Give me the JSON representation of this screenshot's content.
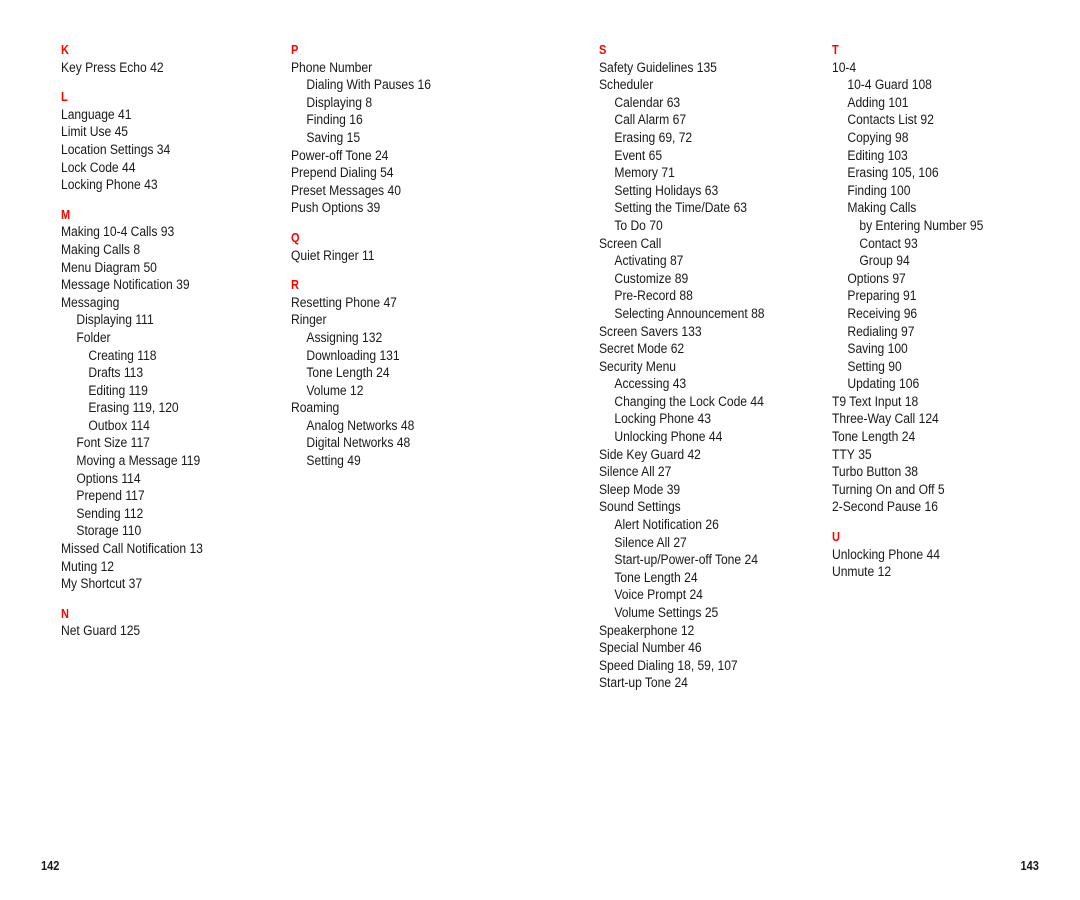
{
  "document": {
    "kind": "printed-index-spread",
    "accent_color": "#ff0000",
    "text_color": "#1a1a1a",
    "background_color": "#ffffff"
  },
  "folio": {
    "left": "142",
    "right": "143"
  },
  "columns": [
    {
      "id": "column-1",
      "groups": [
        {
          "letter": "K",
          "entries": [
            {
              "level": 0,
              "text": "Key Press Echo",
              "page": "42"
            }
          ]
        },
        {
          "letter": "L",
          "entries": [
            {
              "level": 0,
              "text": "Language",
              "page": "41"
            },
            {
              "level": 0,
              "text": "Limit Use",
              "page": "45"
            },
            {
              "level": 0,
              "text": "Location Settings",
              "page": "34"
            },
            {
              "level": 0,
              "text": "Lock Code",
              "page": "44"
            },
            {
              "level": 0,
              "text": "Locking Phone",
              "page": "43"
            }
          ]
        },
        {
          "letter": "M",
          "entries": [
            {
              "level": 0,
              "text": "Making 10-4 Calls",
              "page": "93"
            },
            {
              "level": 0,
              "text": "Making Calls",
              "page": "8"
            },
            {
              "level": 0,
              "text": "Menu Diagram",
              "page": "50"
            },
            {
              "level": 0,
              "text": "Message Notification",
              "page": "39"
            },
            {
              "level": 0,
              "text": "Messaging",
              "page": ""
            },
            {
              "level": 1,
              "text": "Displaying",
              "page": "111"
            },
            {
              "level": 1,
              "text": "Folder",
              "page": ""
            },
            {
              "level": 2,
              "text": "Creating",
              "page": "118"
            },
            {
              "level": 2,
              "text": "Drafts",
              "page": "113"
            },
            {
              "level": 2,
              "text": "Editing",
              "page": "119"
            },
            {
              "level": 2,
              "text": "Erasing",
              "page": "119, 120"
            },
            {
              "level": 2,
              "text": "Outbox",
              "page": "114"
            },
            {
              "level": 1,
              "text": "Font Size",
              "page": "117"
            },
            {
              "level": 1,
              "text": "Moving a Message",
              "page": "119"
            },
            {
              "level": 1,
              "text": "Options",
              "page": "114"
            },
            {
              "level": 1,
              "text": "Prepend",
              "page": "117"
            },
            {
              "level": 1,
              "text": "Sending",
              "page": "112"
            },
            {
              "level": 1,
              "text": "Storage",
              "page": "110"
            },
            {
              "level": 0,
              "text": "Missed Call Notification",
              "page": "13"
            },
            {
              "level": 0,
              "text": "Muting",
              "page": "12"
            },
            {
              "level": 0,
              "text": "My Shortcut",
              "page": "37"
            }
          ]
        },
        {
          "letter": "N",
          "entries": [
            {
              "level": 0,
              "text": "Net Guard",
              "page": "125"
            }
          ]
        }
      ]
    },
    {
      "id": "column-2",
      "groups": [
        {
          "letter": "P",
          "entries": [
            {
              "level": 0,
              "text": "Phone Number",
              "page": ""
            },
            {
              "level": 1,
              "text": "Dialing With Pauses",
              "page": "16"
            },
            {
              "level": 1,
              "text": "Displaying",
              "page": "8"
            },
            {
              "level": 1,
              "text": "Finding",
              "page": "16"
            },
            {
              "level": 1,
              "text": "Saving",
              "page": "15"
            },
            {
              "level": 0,
              "text": "Power-off Tone",
              "page": "24"
            },
            {
              "level": 0,
              "text": "Prepend Dialing",
              "page": "54"
            },
            {
              "level": 0,
              "text": "Preset Messages",
              "page": "40"
            },
            {
              "level": 0,
              "text": "Push Options",
              "page": "39"
            }
          ]
        },
        {
          "letter": "Q",
          "entries": [
            {
              "level": 0,
              "text": "Quiet Ringer",
              "page": "11"
            }
          ]
        },
        {
          "letter": "R",
          "entries": [
            {
              "level": 0,
              "text": "Resetting Phone",
              "page": "47"
            },
            {
              "level": 0,
              "text": "Ringer",
              "page": ""
            },
            {
              "level": 1,
              "text": "Assigning",
              "page": "132"
            },
            {
              "level": 1,
              "text": "Downloading",
              "page": "131"
            },
            {
              "level": 1,
              "text": "Tone Length",
              "page": "24"
            },
            {
              "level": 1,
              "text": "Volume",
              "page": "12"
            },
            {
              "level": 0,
              "text": "Roaming",
              "page": ""
            },
            {
              "level": 1,
              "text": "Analog Networks",
              "page": "48"
            },
            {
              "level": 1,
              "text": "Digital Networks",
              "page": "48"
            },
            {
              "level": 1,
              "text": "Setting",
              "page": "49"
            }
          ]
        }
      ]
    },
    {
      "id": "column-3",
      "groups": [
        {
          "letter": "S",
          "entries": [
            {
              "level": 0,
              "text": "Safety Guidelines",
              "page": "135"
            },
            {
              "level": 0,
              "text": "Scheduler",
              "page": ""
            },
            {
              "level": 1,
              "text": "Calendar",
              "page": "63"
            },
            {
              "level": 1,
              "text": "Call Alarm",
              "page": "67"
            },
            {
              "level": 1,
              "text": "Erasing",
              "page": "69, 72"
            },
            {
              "level": 1,
              "text": "Event",
              "page": "65"
            },
            {
              "level": 1,
              "text": "Memory",
              "page": "71"
            },
            {
              "level": 1,
              "text": "Setting Holidays",
              "page": "63"
            },
            {
              "level": 1,
              "text": "Setting the Time/Date",
              "page": "63"
            },
            {
              "level": 1,
              "text": "To Do",
              "page": "70"
            },
            {
              "level": 0,
              "text": "Screen Call",
              "page": ""
            },
            {
              "level": 1,
              "text": "Activating",
              "page": "87"
            },
            {
              "level": 1,
              "text": "Customize",
              "page": "89"
            },
            {
              "level": 1,
              "text": "Pre-Record",
              "page": "88"
            },
            {
              "level": 1,
              "text": "Selecting Announcement",
              "page": "88"
            },
            {
              "level": 0,
              "text": "Screen Savers",
              "page": "133"
            },
            {
              "level": 0,
              "text": "Secret Mode",
              "page": "62"
            },
            {
              "level": 0,
              "text": "Security Menu",
              "page": ""
            },
            {
              "level": 1,
              "text": "Accessing",
              "page": "43"
            },
            {
              "level": 1,
              "text": "Changing the Lock Code",
              "page": "44"
            },
            {
              "level": 1,
              "text": "Locking Phone",
              "page": "43"
            },
            {
              "level": 1,
              "text": "Unlocking Phone",
              "page": "44"
            },
            {
              "level": 0,
              "text": "Side Key Guard",
              "page": "42"
            },
            {
              "level": 0,
              "text": "Silence All",
              "page": "27"
            },
            {
              "level": 0,
              "text": "Sleep Mode",
              "page": "39"
            },
            {
              "level": 0,
              "text": "Sound Settings",
              "page": ""
            },
            {
              "level": 1,
              "text": "Alert Notification",
              "page": "26"
            },
            {
              "level": 1,
              "text": "Silence All",
              "page": "27"
            },
            {
              "level": 1,
              "text": "Start-up/Power-off Tone",
              "page": "24"
            },
            {
              "level": 1,
              "text": "Tone Length",
              "page": "24"
            },
            {
              "level": 1,
              "text": "Voice Prompt",
              "page": "24"
            },
            {
              "level": 1,
              "text": "Volume Settings",
              "page": "25"
            },
            {
              "level": 0,
              "text": "Speakerphone",
              "page": "12"
            },
            {
              "level": 0,
              "text": "Special Number",
              "page": "46"
            },
            {
              "level": 0,
              "text": "Speed Dialing",
              "page": "18, 59, 107"
            },
            {
              "level": 0,
              "text": "Start-up Tone",
              "page": "24"
            }
          ]
        }
      ]
    },
    {
      "id": "column-4",
      "groups": [
        {
          "letter": "T",
          "entries": [
            {
              "level": 0,
              "text": "10-4",
              "page": ""
            },
            {
              "level": 1,
              "text": "10-4 Guard",
              "page": "108"
            },
            {
              "level": 1,
              "text": "Adding",
              "page": "101"
            },
            {
              "level": 1,
              "text": "Contacts List",
              "page": "92"
            },
            {
              "level": 1,
              "text": "Copying",
              "page": "98"
            },
            {
              "level": 1,
              "text": "Editing",
              "page": "103"
            },
            {
              "level": 1,
              "text": "Erasing",
              "page": "105, 106"
            },
            {
              "level": 1,
              "text": "Finding",
              "page": "100"
            },
            {
              "level": 1,
              "text": "Making Calls",
              "page": ""
            },
            {
              "level": 2,
              "text": "by Entering Number",
              "page": "95"
            },
            {
              "level": 2,
              "text": "Contact",
              "page": "93"
            },
            {
              "level": 2,
              "text": "Group",
              "page": "94"
            },
            {
              "level": 1,
              "text": "Options",
              "page": "97"
            },
            {
              "level": 1,
              "text": "Preparing",
              "page": "91"
            },
            {
              "level": 1,
              "text": "Receiving",
              "page": "96"
            },
            {
              "level": 1,
              "text": "Redialing",
              "page": "97"
            },
            {
              "level": 1,
              "text": "Saving",
              "page": "100"
            },
            {
              "level": 1,
              "text": "Setting",
              "page": "90"
            },
            {
              "level": 1,
              "text": "Updating",
              "page": "106"
            },
            {
              "level": 0,
              "text": "T9 Text Input",
              "page": "18"
            },
            {
              "level": 0,
              "text": "Three-Way Call",
              "page": "124"
            },
            {
              "level": 0,
              "text": "Tone Length",
              "page": "24"
            },
            {
              "level": 0,
              "text": "TTY",
              "page": "35"
            },
            {
              "level": 0,
              "text": "Turbo Button",
              "page": "38"
            },
            {
              "level": 0,
              "text": "Turning On and Off",
              "page": "5"
            },
            {
              "level": 0,
              "text": "2-Second Pause",
              "page": "16"
            }
          ]
        },
        {
          "letter": "U",
          "entries": [
            {
              "level": 0,
              "text": "Unlocking Phone",
              "page": "44"
            },
            {
              "level": 0,
              "text": "Unmute",
              "page": "12"
            }
          ]
        }
      ]
    }
  ]
}
